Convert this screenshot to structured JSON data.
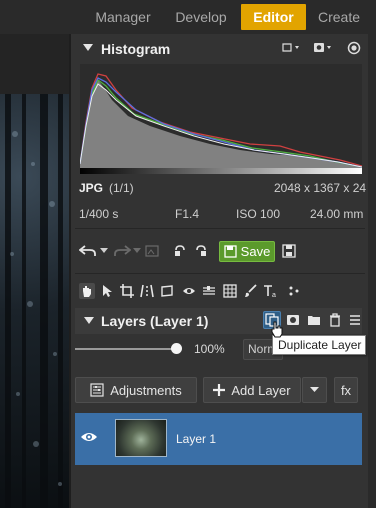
{
  "nav": {
    "tabs": [
      {
        "label": "Manager"
      },
      {
        "label": "Develop"
      },
      {
        "label": "Editor",
        "active": true
      },
      {
        "label": "Create"
      }
    ]
  },
  "histogram": {
    "title": "Histogram",
    "format": "JPG",
    "count": "(1/1)",
    "dimensions": "2048 x 1367 x 24",
    "shutter": "1/400 s",
    "aperture": "F1.4",
    "iso": "ISO 100",
    "focal": "24.00 mm"
  },
  "toolbar": {
    "save_label": "Save"
  },
  "layers": {
    "title": "Layers (Layer 1)",
    "opacity": "100%",
    "blend": "Normal",
    "tooltip": "Duplicate Layer",
    "adjustments_label": "Adjustments",
    "add_layer_label": "Add Layer",
    "fx_label": "fx",
    "items": [
      {
        "name": "Layer 1"
      }
    ]
  },
  "colors": {
    "accent": "#e2a400",
    "save": "#5b9a2c",
    "selected_layer": "#3a6fa7"
  }
}
